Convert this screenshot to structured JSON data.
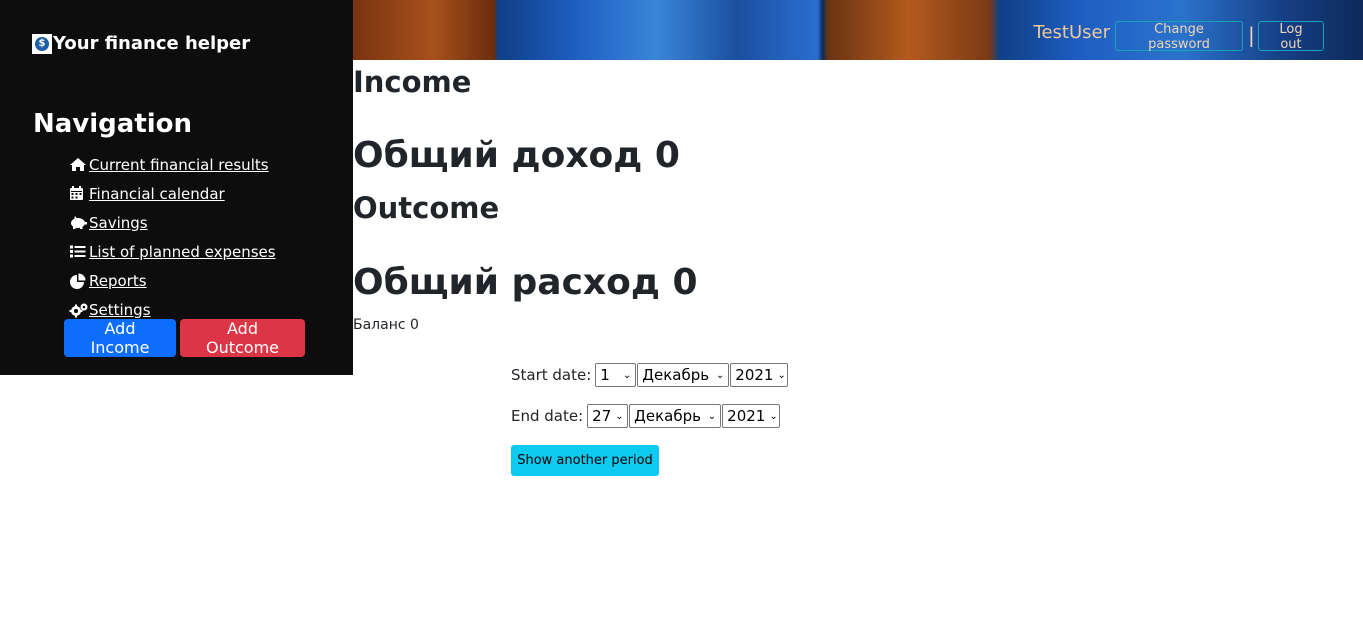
{
  "brand": {
    "title": "Your finance helper",
    "logo_icon": "dollar-coin-icon"
  },
  "navigation": {
    "title": "Navigation",
    "items": [
      {
        "label": " Current financial results",
        "icon": "home-icon"
      },
      {
        "label": " Financial calendar",
        "icon": "calendar-icon"
      },
      {
        "label": " Savings",
        "icon": "piggy-bank-icon"
      },
      {
        "label": " List of planned expenses",
        "icon": "list-icon"
      },
      {
        "label": " Reports",
        "icon": "pie-chart-icon"
      },
      {
        "label": " Settings",
        "icon": "gears-icon"
      }
    ],
    "add_income_label": "Add Income",
    "add_outcome_label": "Add Outcome"
  },
  "header": {
    "username": "TestUser",
    "change_password_label": "Change password",
    "separator": "|",
    "logout_label": "Log out"
  },
  "main": {
    "income_heading": "Income",
    "total_income": "Общий доход 0",
    "outcome_heading": "Outcome",
    "total_outcome": "Общий расход 0",
    "balance": "Баланс 0",
    "start_date": {
      "label": "Start date:",
      "day": "1",
      "month": "Декабрь",
      "year": "2021"
    },
    "end_date": {
      "label": "End date:",
      "day": "27",
      "month": "Декабрь",
      "year": "2021"
    },
    "show_period_label": "Show another period"
  },
  "colors": {
    "sidebar_bg": "#0d0d0d",
    "income_button": "#0d6efd",
    "outcome_button": "#dc3545",
    "show_button": "#0dcaf0",
    "header_button_border": "#17a2b8"
  }
}
